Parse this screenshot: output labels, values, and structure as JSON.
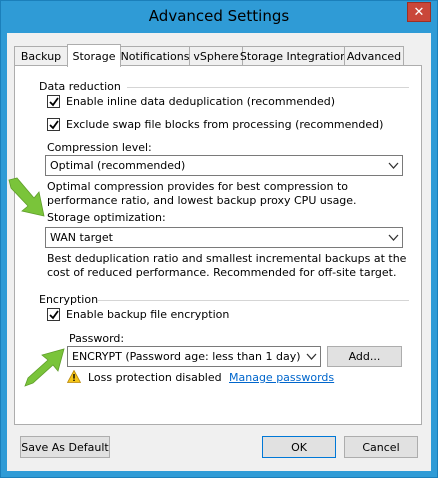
{
  "window": {
    "title": "Advanced Settings",
    "close_glyph": "✕"
  },
  "tabs": [
    {
      "label": "Backup",
      "active": false
    },
    {
      "label": "Storage",
      "active": true
    },
    {
      "label": "Notifications",
      "active": false
    },
    {
      "label": "vSphere",
      "active": false
    },
    {
      "label": "Storage Integration",
      "active": false
    },
    {
      "label": "Advanced",
      "active": false
    }
  ],
  "data_reduction": {
    "heading": "Data reduction",
    "inline_dedup_label": "Enable inline data deduplication (recommended)",
    "inline_dedup_checked": true,
    "exclude_swap_label": "Exclude swap file blocks from processing (recommended)",
    "exclude_swap_checked": true,
    "compression_label": "Compression level:",
    "compression_value": "Optimal (recommended)",
    "compression_desc": "Optimal compression provides for best compression to performance ratio, and lowest backup proxy CPU usage.",
    "storage_opt_label": "Storage optimization:",
    "storage_opt_value": "WAN target",
    "storage_opt_desc": "Best deduplication ratio and smallest incremental backups at the cost of reduced performance. Recommended for off-site target."
  },
  "encryption": {
    "heading": "Encryption",
    "enable_label": "Enable backup file encryption",
    "enable_checked": true,
    "password_label": "Password:",
    "password_value": "ENCRYPT (Password age: less than 1 day)",
    "add_button": "Add...",
    "warning_text": "Loss protection disabled",
    "manage_link": "Manage passwords"
  },
  "footer": {
    "save_default_button": "Save As Default",
    "ok_button": "OK",
    "cancel_button": "Cancel"
  },
  "colors": {
    "title_bar": "#2f9bd6",
    "close_button": "#c9473a",
    "annotation_arrow": "#7ac43a",
    "link": "#0066cc"
  }
}
